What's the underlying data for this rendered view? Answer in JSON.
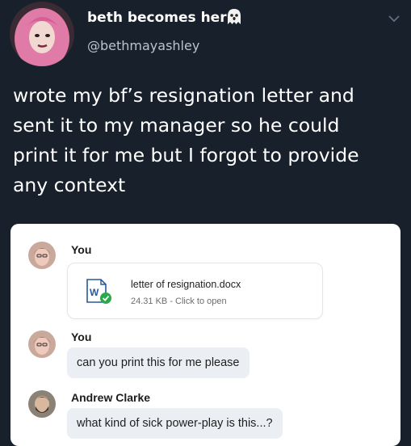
{
  "tweet": {
    "display_name": "beth becomes her",
    "name_emoji": "ghost-icon",
    "handle": "@bethmayashley",
    "text_lines": [
      "wrote my bf’s resignation letter and",
      "sent it to my manager so he could",
      "print it for me but I forgot to provide",
      "any context"
    ],
    "menu_icon": "chevron-down-icon"
  },
  "chat": {
    "messages": [
      {
        "sender": "You",
        "attachment": {
          "name": "letter of resignation.docx",
          "meta": "24.31 KB - Click to open",
          "icon": "word-doc-icon",
          "status_icon": "check-icon"
        }
      },
      {
        "sender": "You",
        "text": "can you print this for me please"
      },
      {
        "sender": "Andrew Clarke",
        "text": "what kind of sick power-play is this...?"
      }
    ]
  },
  "colors": {
    "background": "#17202b",
    "card": "#ffffff",
    "bubble": "#ebeef3",
    "word_blue": "#2b579a",
    "check_green": "#2aa84a"
  }
}
